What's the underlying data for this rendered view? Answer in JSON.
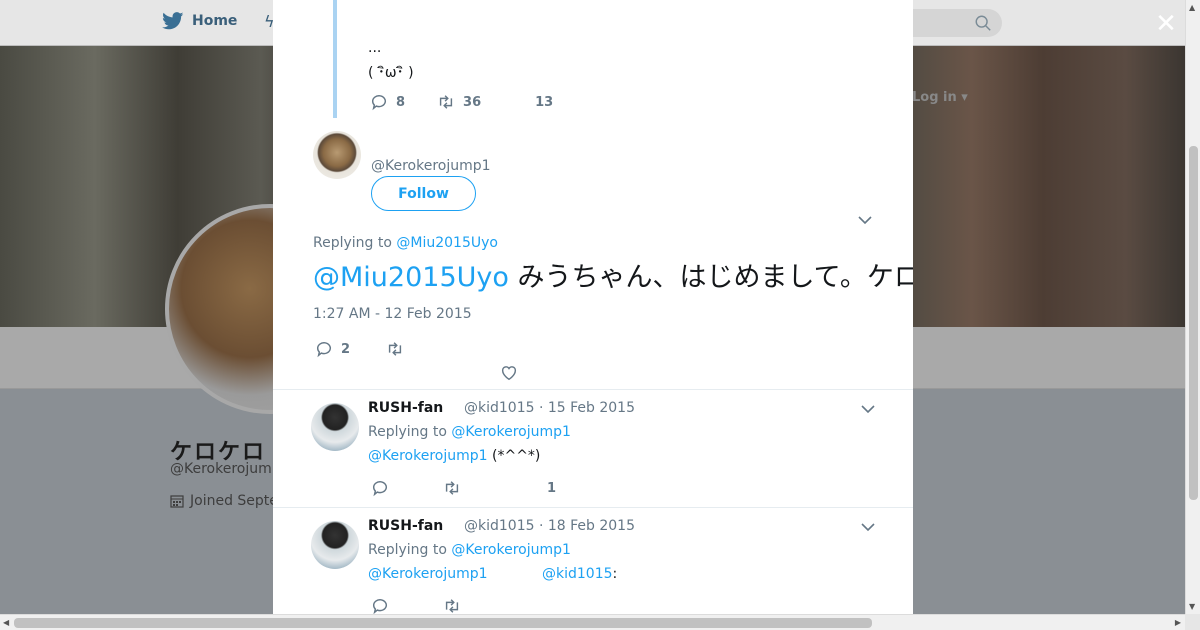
{
  "background": {
    "nav": {
      "home_label": "Home"
    },
    "login_label": "Log in",
    "profile": {
      "name": "ケロケロ",
      "handle": "@Kerokerojum",
      "joined": "Joined Septe"
    }
  },
  "modal": {
    "prev_tweet": {
      "lines": [
        "...",
        "( ･ิω･ิ )"
      ],
      "replies": "8",
      "retweets": "36",
      "likes": "13"
    },
    "focus_tweet": {
      "handle": "@Kerokerojump1",
      "follow_label": "Follow",
      "replying_prefix": "Replying to",
      "replying_to": "@Miu2015Uyo",
      "mention": "@Miu2015Uyo",
      "text": "みうちゃん、はじめまして。ケロケロです。よろしくお願いします。かわいいですね。",
      "timestamp": "1:27 AM - 12 Feb 2015",
      "replies": "2"
    },
    "replies": [
      {
        "name": "RUSH-fan",
        "meta": "@kid1015 · 15 Feb 2015",
        "replying_prefix": "Replying to",
        "replying_to": "@Kerokerojump1",
        "mention": "@Kerokerojump1",
        "body": "(*^^*)",
        "likes": "1"
      },
      {
        "name": "RUSH-fan",
        "meta": "@kid1015 · 18 Feb 2015",
        "replying_prefix": "Replying to",
        "replying_to": "@Kerokerojump1",
        "mention": "@Kerokerojump1",
        "mention2": "@kid1015",
        "body_tail": ":"
      }
    ]
  },
  "colors": {
    "accent": "#1da1f2",
    "thread_line": "#aad3f2",
    "muted": "#657786"
  }
}
